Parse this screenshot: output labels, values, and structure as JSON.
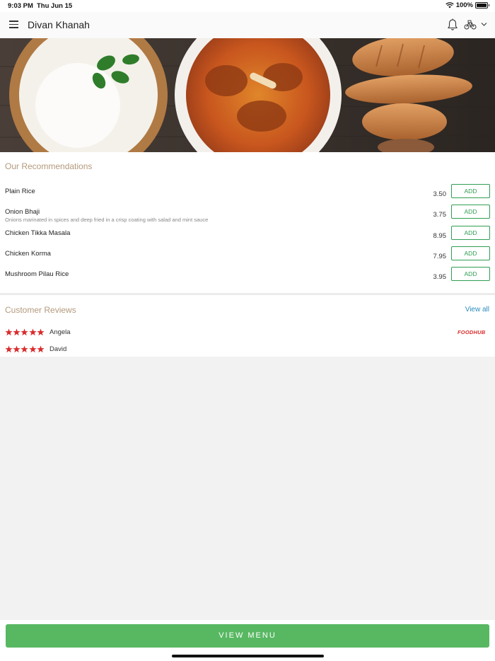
{
  "status_bar": {
    "time": "9:03 PM",
    "date": "Thu Jun 15",
    "battery": "100%"
  },
  "header": {
    "title": "Divan Khanah",
    "icons": [
      "menu-icon",
      "bell-icon",
      "delivery-bike-icon",
      "chevron-down-icon"
    ]
  },
  "recommendations": {
    "title": "Our Recommendations",
    "add_label": "ADD",
    "items": [
      {
        "name": "Plain Rice",
        "description": "",
        "price": "3.50"
      },
      {
        "name": "Onion Bhaji",
        "description": "Onions marinated in spices and deep fried in a crisp coating with salad and mint sauce",
        "price": "3.75"
      },
      {
        "name": "Chicken Tikka Masala",
        "description": "",
        "price": "8.95"
      },
      {
        "name": "Chicken Korma",
        "description": "",
        "price": "7.95"
      },
      {
        "name": "Mushroom Pilau Rice",
        "description": "",
        "price": "3.95"
      }
    ]
  },
  "reviews": {
    "title": "Customer Reviews",
    "view_all": "View all",
    "source_logo": "FOODHUB",
    "items": [
      {
        "name": "Angela",
        "rating": 5
      },
      {
        "name": "David",
        "rating": 5
      }
    ]
  },
  "footer": {
    "button_label": "VIEW MENU"
  },
  "colors": {
    "accent_green": "#58b862",
    "add_border": "#2f9e52",
    "section_title": "#b49a7c",
    "link": "#2a8dbf",
    "star": "#d92b2b"
  }
}
